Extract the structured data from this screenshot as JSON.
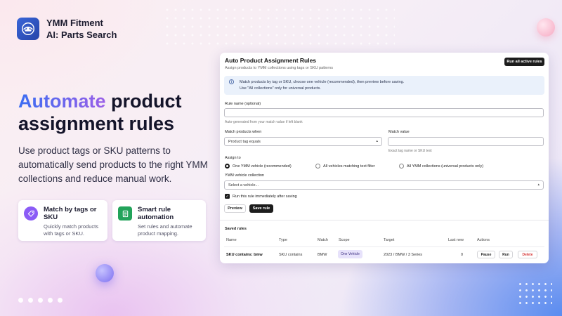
{
  "brand": {
    "line1": "YMM Fitment",
    "line2": "AI: Parts Search"
  },
  "hero": {
    "headline_accent": "Automate",
    "headline_rest": "product assignment rules",
    "subtext": "Use product tags or SKU patterns to automatically send products to the right YMM collections and reduce manual work."
  },
  "features": [
    {
      "title": "Match by tags or SKU",
      "desc": "Quickly match products with tags or SKU.",
      "icon": "tag-icon",
      "color": "#8b5cf6"
    },
    {
      "title": "Smart rule automation",
      "desc": "Set rules and automate product mapping.",
      "icon": "document-icon",
      "color": "#22a35a"
    }
  ],
  "app": {
    "title": "Auto Product Assignment Rules",
    "subtitle": "Assign products to YMM collections using tags or SKU patterns",
    "run_all_label": "Run all active rules",
    "info_line1": "Match products by tag or SKU, choose one vehicle (recommended), then preview before saving.",
    "info_line2": "Use \"All collections\" only for universal products.",
    "rule_name_label": "Rule name (optional)",
    "rule_name_value": "",
    "rule_name_hint": "Auto-generated from your match value if left blank",
    "match_when_label": "Match products when",
    "match_when_value": "Product tag equals",
    "match_value_label": "Match value",
    "match_value_value": "",
    "match_value_hint": "Exact tag name or SKU text",
    "assign_to_label": "Assign to",
    "assign_options": [
      {
        "label": "One YMM vehicle (recommended)",
        "selected": true
      },
      {
        "label": "All vehicles matching text filter",
        "selected": false
      },
      {
        "label": "All YMM collections (universal products only)",
        "selected": false
      }
    ],
    "collection_label": "YMM vehicle collection",
    "collection_value": "Select a vehicle...",
    "run_immediately_label": "Run this rule immediately after saving",
    "run_immediately_checked": true,
    "preview_label": "Preview",
    "save_rule_label": "Save rule",
    "saved_rules_title": "Saved rules",
    "columns": [
      "Name",
      "Type",
      "Match",
      "Scope",
      "Target",
      "Last new",
      "Actions"
    ],
    "rows": [
      {
        "name": "SKU contains: bmw",
        "type": "SKU contains",
        "match": "BMW",
        "scope": "One Vehicle",
        "target": "2023 / BMW / 3 Series",
        "last_new": "0",
        "actions": {
          "pause": "Pause",
          "run": "Run",
          "delete": "Delete"
        }
      }
    ]
  },
  "colors": {
    "accent_blue": "#3a6ef2",
    "accent_purple": "#9b5fe8",
    "delete_red": "#d63a3a",
    "scope_badge_bg": "#e7e2fb"
  }
}
